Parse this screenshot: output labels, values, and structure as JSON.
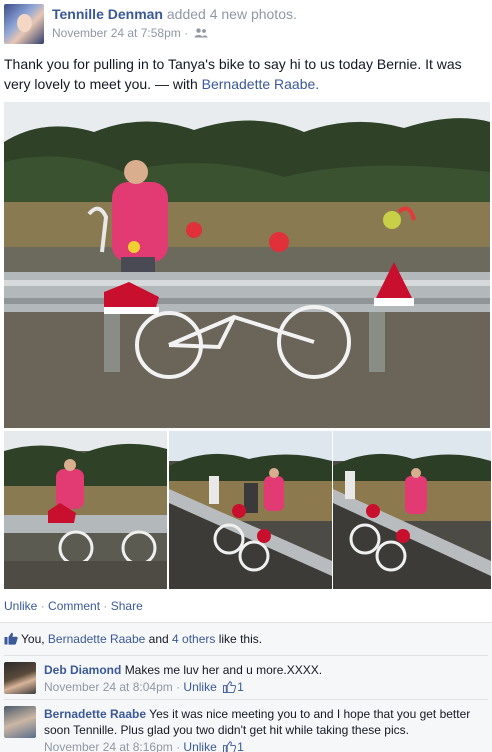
{
  "post": {
    "author": "Tennille Denman",
    "action": "added 4 new photos.",
    "timestamp": "November 24 at 7:58pm",
    "separator": "·",
    "privacy_icon": "friends-icon",
    "text": "Thank you for pulling in to Tanya's bike to say hi to us today Bernie. It was very lovely to meet you. — with ",
    "with_name": "Bernadette Raabe."
  },
  "photos": {
    "main_alt": "ghost-bike-memorial-with-woman",
    "thumbnails": [
      "woman-at-memorial-bike",
      "people-at-guardrail-bike",
      "people-at-guardrail-bike-2"
    ]
  },
  "actions": {
    "unlike": "Unlike",
    "comment": "Comment",
    "share": "Share",
    "sep": " · "
  },
  "likes": {
    "prefix": "You, ",
    "name": "Bernadette Raabe",
    "middle": " and ",
    "others": "4 others",
    "suffix": " like this."
  },
  "comments": [
    {
      "name": "Deb Diamond",
      "text": "Makes me luv her and u more.XXXX.",
      "timestamp": "November 24 at 8:04pm",
      "sep": " · ",
      "unlike": "Unlike",
      "likes": "1"
    },
    {
      "name": "Bernadette Raabe",
      "text": "Yes it was nice meeting you to and I hope that you get better soon Tennille. Plus glad you two didn't get hit while taking these pics.",
      "timestamp": "November 24 at 8:16pm",
      "sep": " · ",
      "unlike": "Unlike",
      "likes": "1"
    }
  ],
  "colors": {
    "link": "#3b5998",
    "muted": "#9197a3",
    "panel": "#f6f7f9"
  }
}
